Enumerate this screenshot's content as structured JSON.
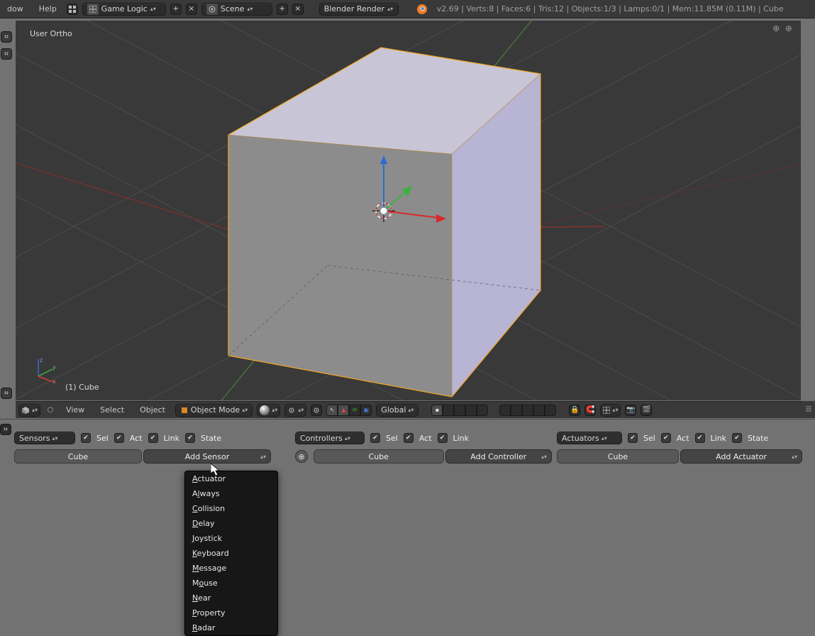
{
  "header": {
    "menus": [
      "dow",
      "Help"
    ],
    "layout_dropdown": "Game Logic",
    "scene_dropdown": "Scene",
    "render_engine": "Blender Render",
    "info": "v2.69 | Verts:8 | Faces:6 | Tris:12 | Objects:1/3 | Lamps:0/1 | Mem:11.85M (0.11M) | Cube"
  },
  "viewport": {
    "view_label": "User Ortho",
    "object_label": "(1) Cube"
  },
  "vp_header": {
    "menus": [
      "View",
      "Select",
      "Object"
    ],
    "mode": "Object Mode",
    "orientation": "Global"
  },
  "logic": {
    "sensors": {
      "dropdown": "Sensors",
      "checks": [
        "Sel",
        "Act",
        "Link",
        "State"
      ],
      "object": "Cube",
      "add_label": "Add Sensor",
      "menu": [
        "Actuator",
        "Always",
        "Collision",
        "Delay",
        "Joystick",
        "Keyboard",
        "Message",
        "Mouse",
        "Near",
        "Property",
        "Radar"
      ]
    },
    "controllers": {
      "dropdown": "Controllers",
      "checks": [
        "Sel",
        "Act",
        "Link"
      ],
      "object": "Cube",
      "add_label": "Add Controller"
    },
    "actuators": {
      "dropdown": "Actuators",
      "checks": [
        "Sel",
        "Act",
        "Link",
        "State"
      ],
      "object": "Cube",
      "add_label": "Add Actuator"
    }
  }
}
